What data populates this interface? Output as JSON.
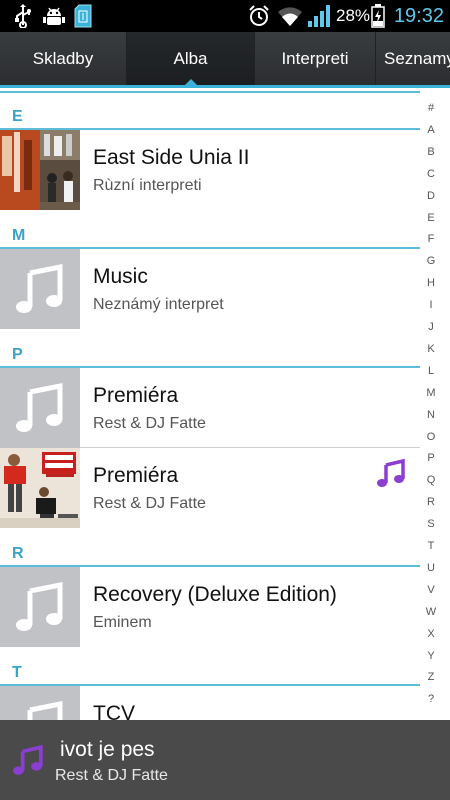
{
  "status_bar": {
    "icons": [
      "usb-icon",
      "android-debug-icon",
      "sd-card-icon",
      "alarm-icon",
      "wifi-icon",
      "signal-icon",
      "battery-charging-icon"
    ],
    "battery": "28%",
    "time": "19:32"
  },
  "tabs": [
    {
      "label": "Skladby",
      "active": false
    },
    {
      "label": "Alba",
      "active": true
    },
    {
      "label": "Interpreti",
      "active": false
    },
    {
      "label": "Seznamy",
      "active": false
    }
  ],
  "list": {
    "sections": [
      {
        "letter": "E",
        "items": [
          {
            "title": "East Side Unia II",
            "subtitle": "Rùzní interpreti",
            "art": "cover-east-side"
          }
        ]
      },
      {
        "letter": "M",
        "items": [
          {
            "title": "Music",
            "subtitle": "Neznámý interpret",
            "art": "music-note-placeholder"
          }
        ]
      },
      {
        "letter": "P",
        "items": [
          {
            "title": "Premiéra",
            "subtitle": "Rest & DJ Fatte",
            "art": "music-note-placeholder"
          },
          {
            "title": "Premiéra",
            "subtitle": "Rest & DJ Fatte",
            "art": "cover-premiera",
            "now_playing": true
          }
        ]
      },
      {
        "letter": "R",
        "items": [
          {
            "title": "Recovery (Deluxe Edition)",
            "subtitle": "Eminem",
            "art": "music-note-placeholder"
          }
        ]
      },
      {
        "letter": "T",
        "items": [
          {
            "title": "TCV",
            "subtitle": "",
            "art": "music-note-placeholder"
          }
        ]
      }
    ]
  },
  "index_letters": [
    "#",
    "A",
    "B",
    "C",
    "D",
    "E",
    "F",
    "G",
    "H",
    "I",
    "J",
    "K",
    "L",
    "M",
    "N",
    "O",
    "P",
    "Q",
    "R",
    "S",
    "T",
    "U",
    "V",
    "W",
    "X",
    "Y",
    "Z",
    "?"
  ],
  "now_playing": {
    "title": "ivot je pes",
    "artist": "Rest & DJ Fatte"
  },
  "colors": {
    "accent": "#39b3d7",
    "section_letter": "#39a3c9",
    "clock": "#5ec8ea",
    "playing_icon": "#8a3fd1",
    "placeholder_bg": "#c1c2c5"
  }
}
